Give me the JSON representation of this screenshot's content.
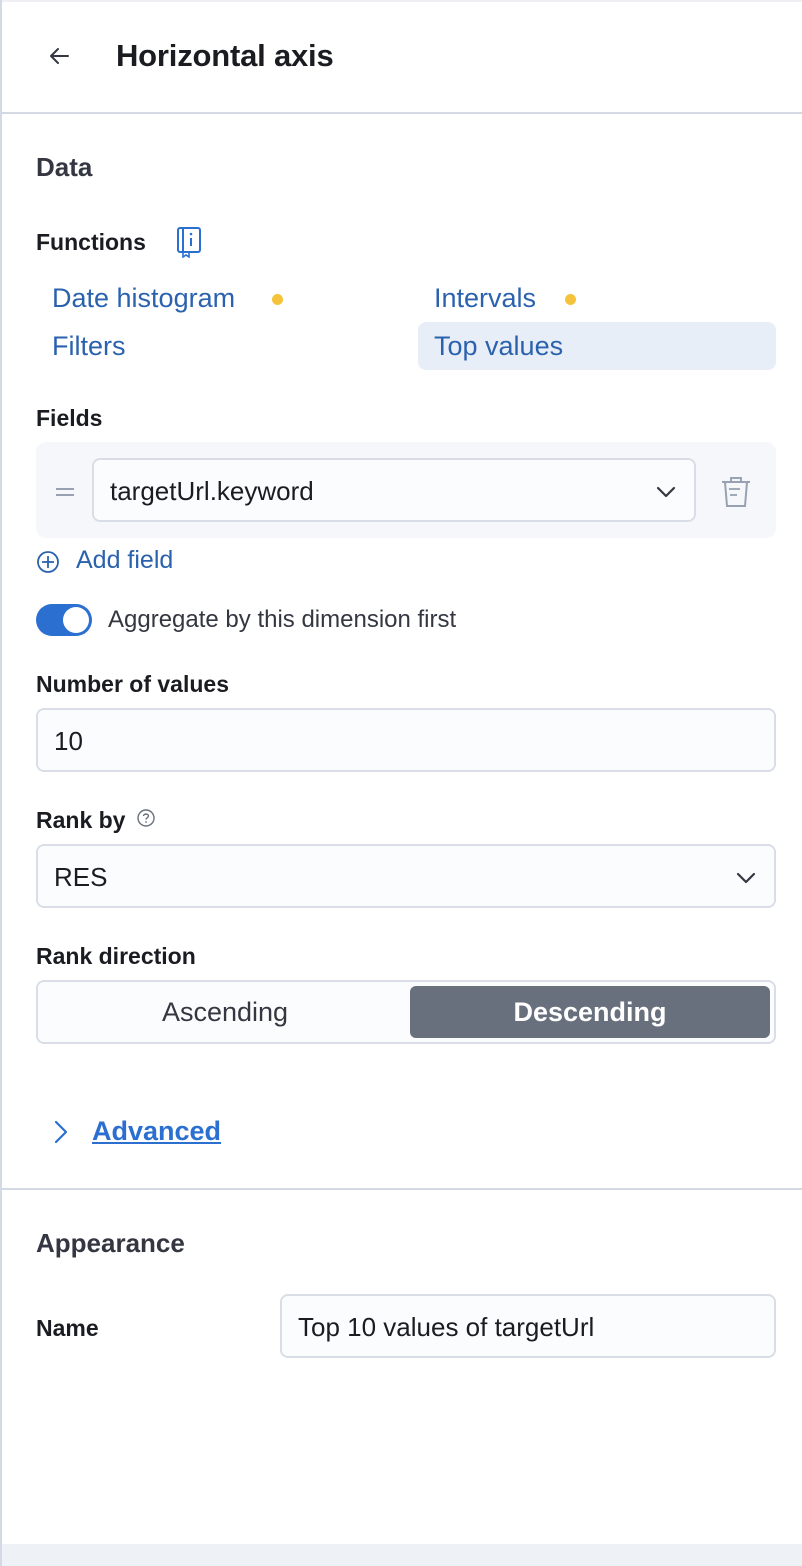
{
  "header": {
    "title": "Horizontal axis",
    "back_icon": "arrow-left-icon"
  },
  "data_section": {
    "title": "Data",
    "functions_label": "Functions",
    "functions_doc_icon": "documentation-book-icon",
    "functions": [
      {
        "label": "Date histogram",
        "warning_dot": true
      },
      {
        "label": "Intervals",
        "warning_dot": true
      },
      {
        "label": "Filters",
        "warning_dot": false
      },
      {
        "label": "Top values",
        "warning_dot": false,
        "selected": true
      }
    ],
    "fields_label": "Fields",
    "field_value": "targetUrl.keyword",
    "add_field_label": "Add field",
    "aggregate_toggle": {
      "label": "Aggregate by this dimension first",
      "on": true
    },
    "number_of_values_label": "Number of values",
    "number_of_values": "10",
    "rank_by_label": "Rank by",
    "rank_by_value": "RES",
    "rank_direction_label": "Rank direction",
    "rank_direction_options": [
      "Ascending",
      "Descending"
    ],
    "rank_direction_selected": "Descending",
    "advanced_label": "Advanced"
  },
  "appearance_section": {
    "title": "Appearance",
    "name_label": "Name",
    "name_value": "Top 10 values of targetUrl"
  },
  "colors": {
    "accent": "#2b6fd0",
    "link": "#2b62ad",
    "warning_dot": "#f5c33b",
    "selected_segment": "#69707d"
  }
}
